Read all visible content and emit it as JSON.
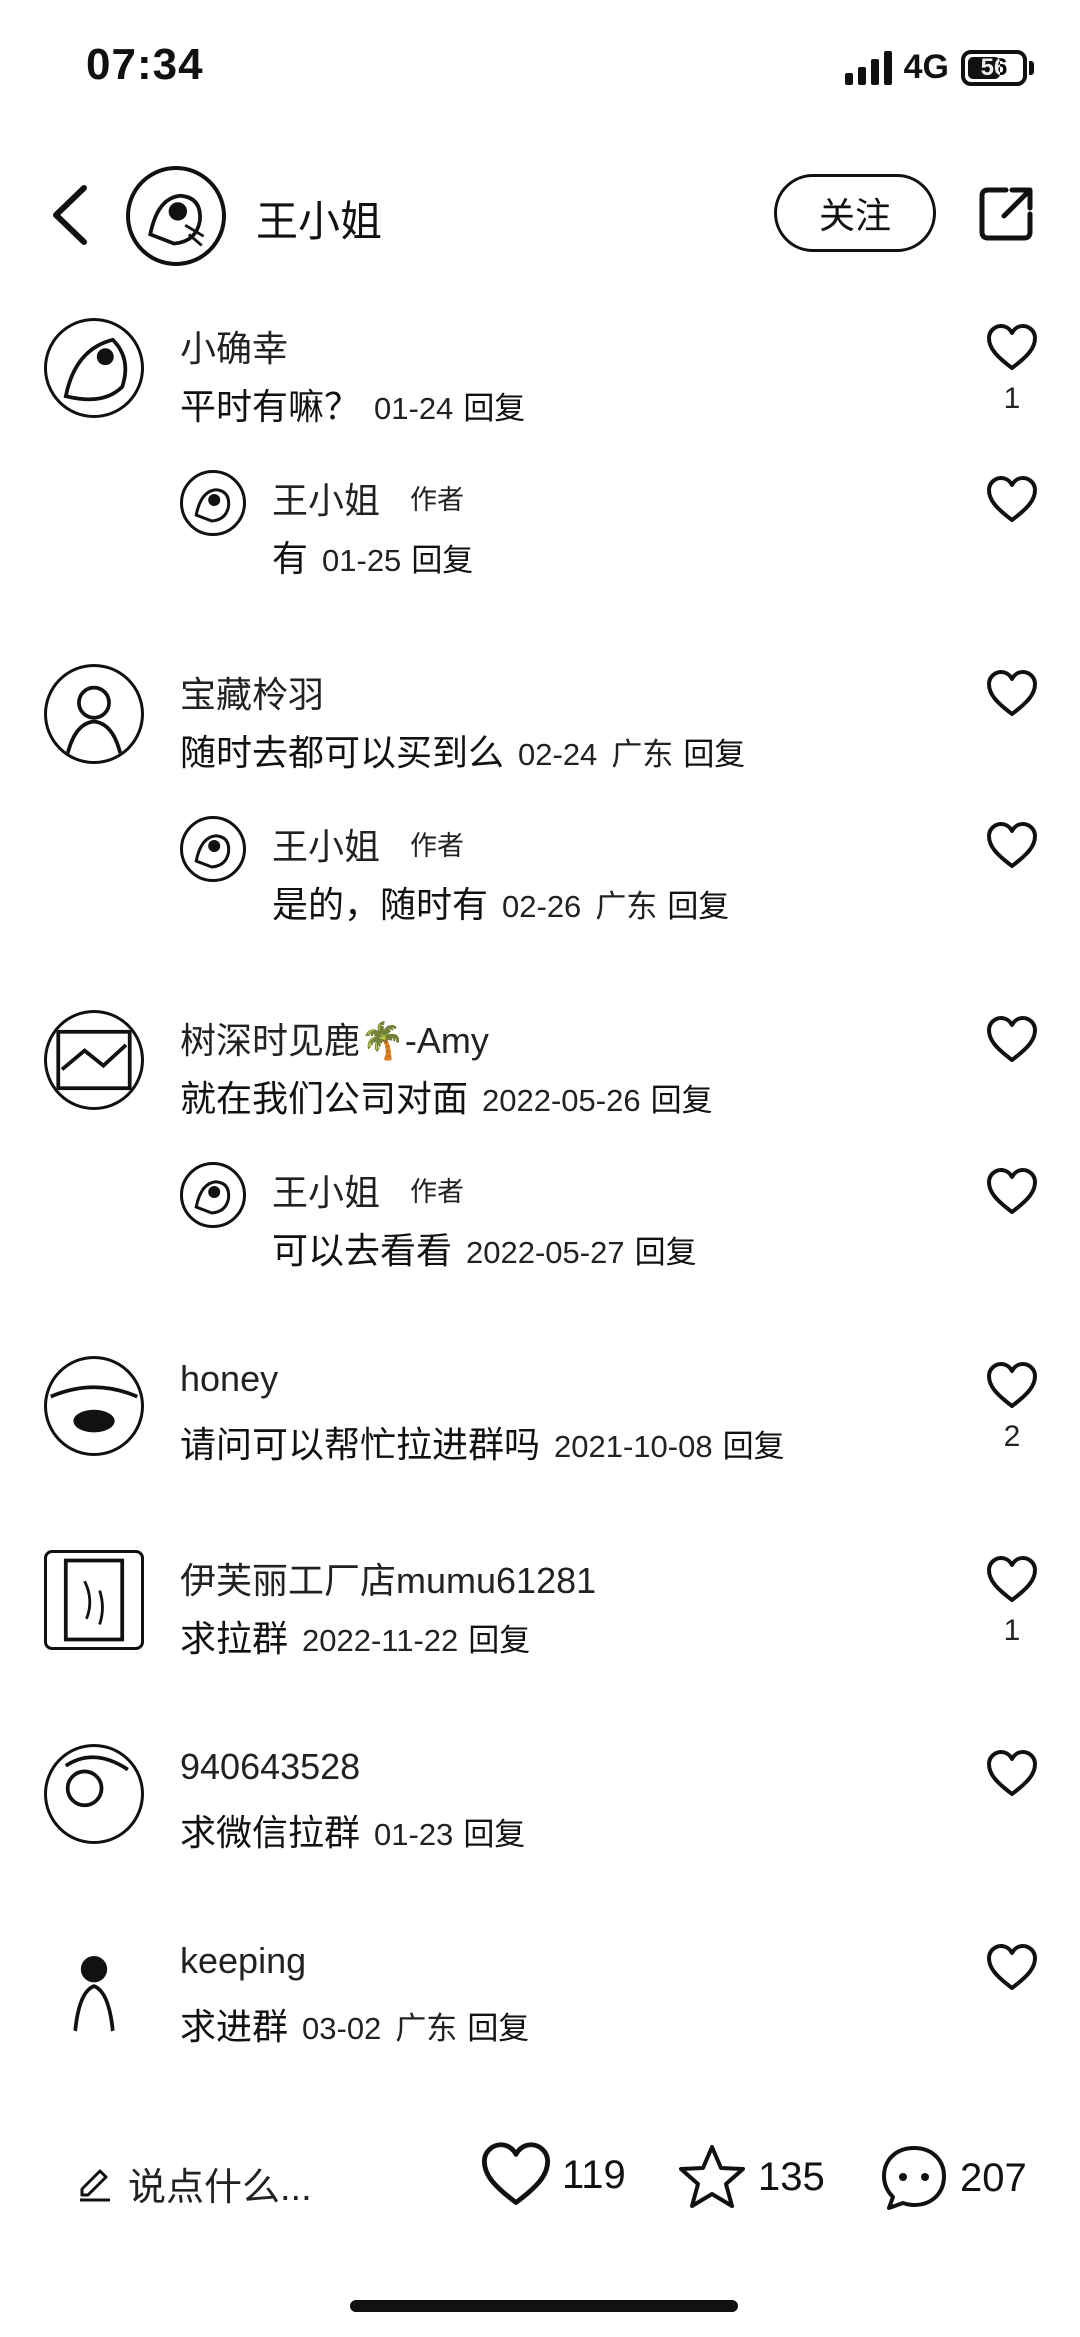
{
  "status_bar": {
    "time": "07:34",
    "network": "4G",
    "battery": "56"
  },
  "header": {
    "name": "王小姐",
    "follow_label": "关注"
  },
  "comments": [
    {
      "name": "小确幸",
      "text": "平时有嘛？",
      "date": "01-24",
      "region": "",
      "reply": "回复",
      "likes": "1",
      "sub": {
        "name": "王小姐",
        "tag": "作者",
        "text": "有",
        "date": "01-25",
        "region": "",
        "reply": "回复"
      }
    },
    {
      "name": "宝藏柃羽",
      "text": "随时去都可以买到么",
      "date": "02-24",
      "region": "广东",
      "reply": "回复",
      "likes": "",
      "sub": {
        "name": "王小姐",
        "tag": "作者",
        "text": "是的，随时有",
        "date": "02-26",
        "region": "广东",
        "reply": "回复"
      }
    },
    {
      "name": "树深时见鹿🌴-Amy",
      "text": "就在我们公司对面",
      "date": "2022-05-26",
      "region": "",
      "reply": "回复",
      "likes": "",
      "sub": {
        "name": "王小姐",
        "tag": "作者",
        "text": "可以去看看",
        "date": "2022-05-27",
        "region": "",
        "reply": "回复"
      }
    },
    {
      "name": "honey",
      "text": "请问可以帮忙拉进群吗",
      "date": "2021-10-08",
      "region": "",
      "reply": "回复",
      "likes": "2"
    },
    {
      "name": "伊芙丽工厂店mumu61281",
      "text": "求拉群",
      "date": "2022-11-22",
      "region": "",
      "reply": "回复",
      "likes": "1"
    },
    {
      "name": "940643528",
      "text": "求微信拉群",
      "date": "01-23",
      "region": "",
      "reply": "回复",
      "likes": ""
    },
    {
      "name": "keeping",
      "text": "求进群",
      "date": "03-02",
      "region": "广东",
      "reply": "回复",
      "likes": ""
    }
  ],
  "bottom_bar": {
    "input_placeholder": "说点什么...",
    "likes": "119",
    "favorites": "135",
    "comments": "207"
  }
}
